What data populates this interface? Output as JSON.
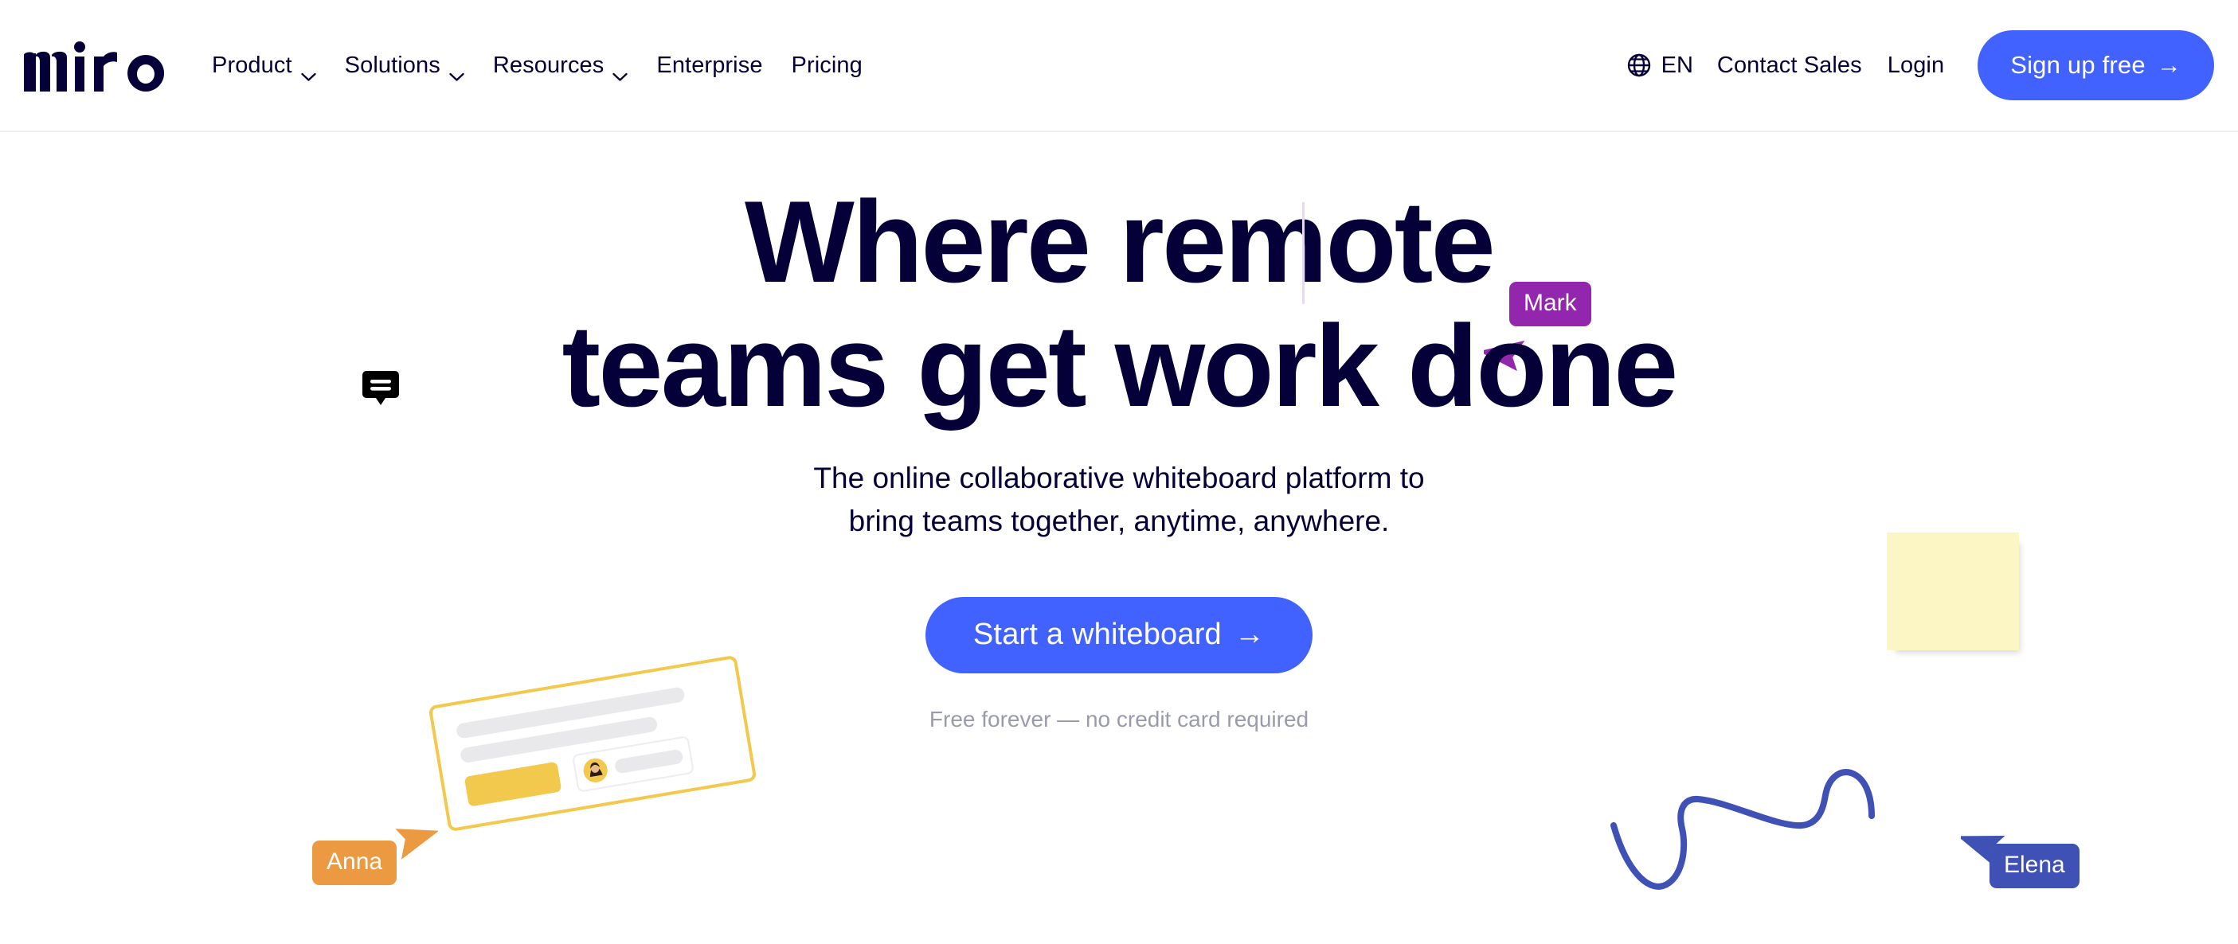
{
  "brand": {
    "logo_text": "miro",
    "logo_color": "#050038",
    "accent_blue": "#4262ff"
  },
  "nav": {
    "links": [
      {
        "label": "Product",
        "has_dropdown": true,
        "icon": "chevron-down-icon"
      },
      {
        "label": "Solutions",
        "has_dropdown": true,
        "icon": "chevron-down-icon"
      },
      {
        "label": "Resources",
        "has_dropdown": true,
        "icon": "chevron-down-icon"
      },
      {
        "label": "Enterprise",
        "has_dropdown": false
      },
      {
        "label": "Pricing",
        "has_dropdown": false
      }
    ],
    "language": {
      "icon": "globe-icon",
      "label": "EN"
    },
    "contact_sales": "Contact Sales",
    "login": "Login",
    "signup": {
      "label": "Sign up free",
      "arrow": "→",
      "bg": "#4262ff",
      "color": "#ffffff"
    }
  },
  "hero": {
    "headline_line1": "Where remote",
    "headline_line2": "teams get work done",
    "headline_color": "#050038",
    "caret_color": "#e9d8f2",
    "subhead_line1": "The online collaborative whiteboard platform to",
    "subhead_line2": "bring teams together, anytime, anywhere.",
    "cta": {
      "label": "Start a whiteboard",
      "arrow": "→",
      "bg": "#4262ff",
      "color": "#ffffff"
    },
    "cta_note": "Free forever — no credit card required",
    "cta_note_color": "#9a9aad"
  },
  "decorations": {
    "comment_icon": {
      "name": "comment-bubble-icon",
      "color": "#000000"
    },
    "cursors": [
      {
        "name": "Mark",
        "color": "#9226ad"
      },
      {
        "name": "Anna",
        "color": "#ec9a41"
      },
      {
        "name": "Elena",
        "color": "#4051b5"
      }
    ],
    "sticky_note": {
      "color": "#fcf6c4"
    },
    "squiggle": {
      "color": "#3f51b5"
    },
    "comment_card": {
      "border_color": "#f2c94c",
      "chip_color": "#f2c94c",
      "bar_color": "#e9e9ec"
    }
  }
}
